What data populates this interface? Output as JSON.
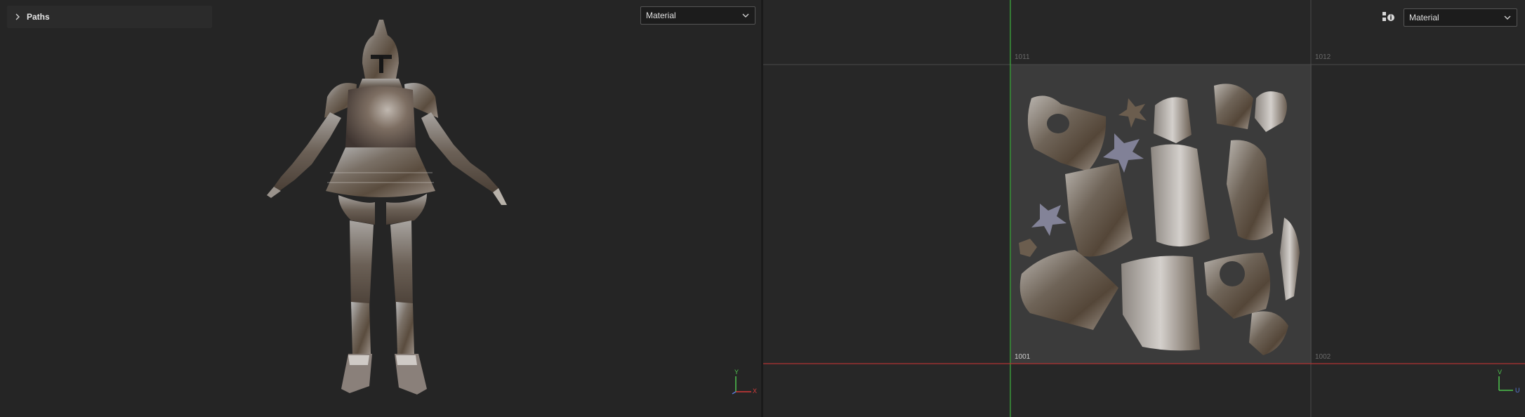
{
  "viewport_3d": {
    "paths_panel": {
      "label": "Paths"
    },
    "display_mode": "Material",
    "gizmo": {
      "y_label": "Y",
      "x_label": "X"
    }
  },
  "viewport_uv": {
    "display_mode": "Material",
    "tiles": {
      "t1011": "1011",
      "t1012": "1012",
      "t1001": "1001",
      "t1002": "1002"
    },
    "gizmo": {
      "v_label": "V",
      "u_label": "U"
    }
  },
  "colors": {
    "axis_green": "#4fc44f",
    "axis_red": "#d43a3a",
    "axis_blue": "#5a7bd8"
  }
}
